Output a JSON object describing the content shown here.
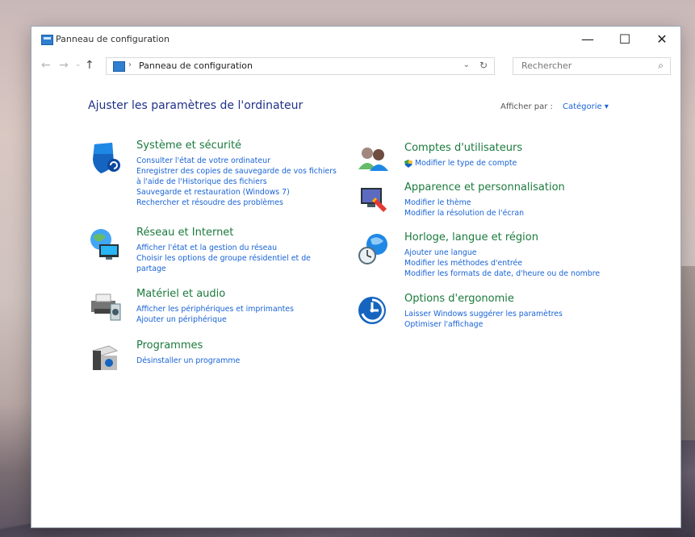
{
  "window": {
    "title": "Panneau de configuration",
    "controls": {
      "minimize": "—",
      "maximize": "☐",
      "close": "✕"
    }
  },
  "toolbar": {
    "back": "←",
    "forward": "→",
    "recent": "⌄",
    "up": "↑",
    "breadcrumb_sep": "›",
    "breadcrumb": "Panneau de configuration",
    "dropdown": "⌄",
    "refresh": "↻",
    "search_placeholder": "Rechercher",
    "search_icon": "⌕"
  },
  "main": {
    "page_title": "Ajuster les paramètres de l'ordinateur",
    "view_by_label": "Afficher par :",
    "view_by_value": "Catégorie ▾"
  },
  "left_categories": [
    {
      "icon": "shield-icon",
      "title": "Système et sécurité",
      "links": [
        "Consulter l'état de votre ordinateur",
        "Enregistrer des copies de sauvegarde de vos fichiers",
        "à l'aide de l'Historique des fichiers",
        "Sauvegarde et restauration (Windows 7)",
        "Rechercher et résoudre des problèmes"
      ]
    },
    {
      "icon": "network-globe-icon",
      "title": "Réseau et Internet",
      "links": [
        "Afficher l'état et la gestion du réseau",
        "Choisir les options de groupe résidentiel et de",
        "partage"
      ]
    },
    {
      "icon": "printer-speaker-icon",
      "title": "Matériel et audio",
      "links": [
        "Afficher les périphériques et imprimantes",
        "Ajouter un périphérique"
      ]
    },
    {
      "icon": "programs-box-icon",
      "title": "Programmes",
      "links": [
        "Désinstaller un programme"
      ]
    }
  ],
  "right_categories": [
    {
      "icon": "users-icon",
      "title": "Comptes d'utilisateurs",
      "links": [
        "Modifier le type de compte"
      ]
    },
    {
      "icon": "display-personalization-icon",
      "title": "Apparence et personnalisation",
      "links": [
        "Modifier le thème",
        "Modifier la résolution de l'écran"
      ]
    },
    {
      "icon": "clock-globe-icon",
      "title": "Horloge, langue et région",
      "links": [
        "Ajouter une langue",
        "Modifier les méthodes d'entrée",
        "Modifier les formats de date, d'heure ou de nombre"
      ]
    },
    {
      "icon": "ease-of-access-icon",
      "title": "Options d'ergonomie",
      "links": [
        "Laisser Windows suggérer les paramètres",
        "Optimiser l'affichage"
      ]
    }
  ],
  "colors": {
    "category_title": "#1b7a3d",
    "link": "#1a64d6",
    "page_title": "#1e3287"
  }
}
